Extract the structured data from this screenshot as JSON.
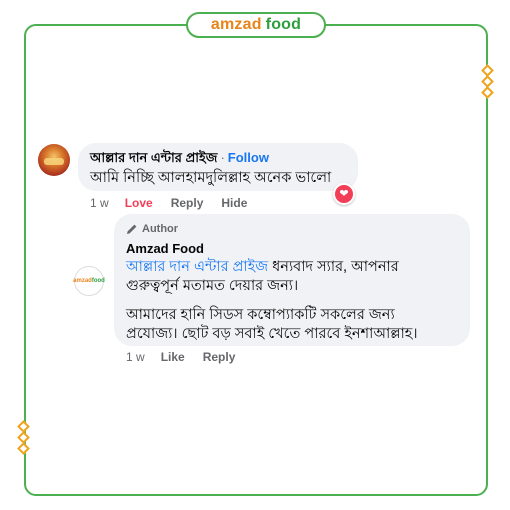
{
  "brand": {
    "part1": "amzad",
    "part2": "food"
  },
  "comment": {
    "author": "আল্লার দান এন্টার প্রাইজ",
    "separator": "·",
    "follow_label": "Follow",
    "text": "আমি নিচ্ছি আলহামদুলিল্লাহ অনেক ভালো",
    "time": "1 w",
    "love_label": "Love",
    "reply_label": "Reply",
    "hide_label": "Hide",
    "reaction_icon": "heart-icon"
  },
  "reply": {
    "author_badge": "Author",
    "author_name": "Amzad Food",
    "avatar_text": {
      "part1": "amzad",
      "part2": "food"
    },
    "mention": "আল্লার দান এন্টার প্রাইজ",
    "text1_line1_rest": " ধন্যবাদ স্যার, আপনার",
    "text1_line2": "গুরুত্বপূর্ন মতামত দেয়ার জন্য।",
    "text2_line1": "আমাদের হানি সিডস কম্বোপ্যাকটি সকলের জন্য",
    "text2_line2": "প্রযোজ্য। ছোট বড় সবাই খেতে পারবে ইনশাআল্লাহ।",
    "time": "1 w",
    "like_label": "Like",
    "reply_label": "Reply"
  },
  "colors": {
    "frame": "#4caf50",
    "accent_orange": "#e8841a",
    "accent_green": "#2e9e3f",
    "link": "#1877f2",
    "love": "#f33e58"
  }
}
